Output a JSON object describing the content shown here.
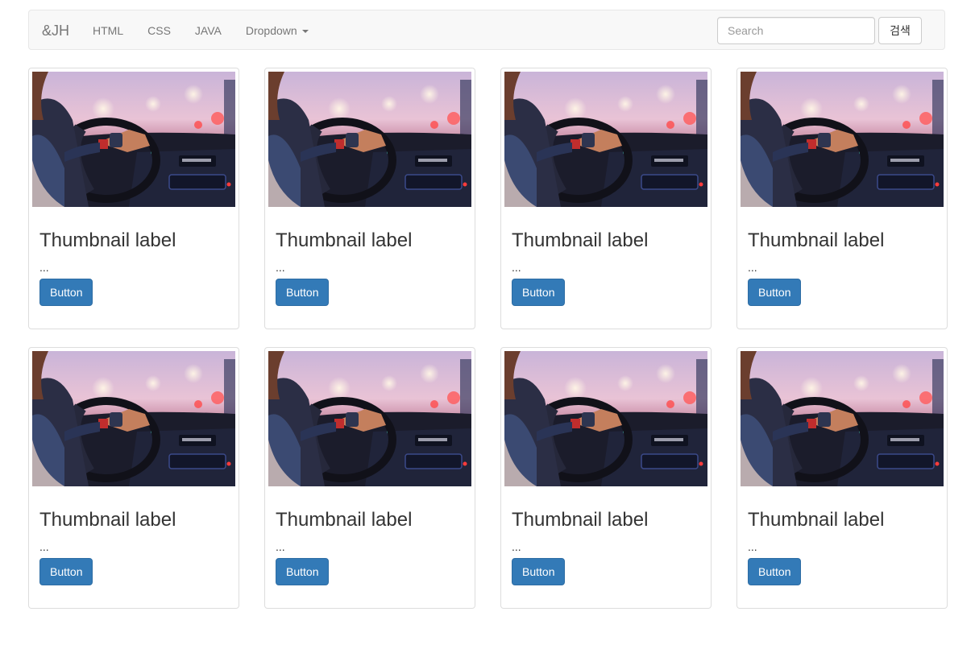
{
  "navbar": {
    "brand": "&JH",
    "items": [
      {
        "label": "HTML"
      },
      {
        "label": "CSS"
      },
      {
        "label": "JAVA"
      },
      {
        "label": "Dropdown"
      }
    ],
    "search_placeholder": "Search",
    "search_button": "검색"
  },
  "cards": [
    {
      "title": "Thumbnail label",
      "text": "...",
      "button": "Button"
    },
    {
      "title": "Thumbnail label",
      "text": "...",
      "button": "Button"
    },
    {
      "title": "Thumbnail label",
      "text": "...",
      "button": "Button"
    },
    {
      "title": "Thumbnail label",
      "text": "...",
      "button": "Button"
    },
    {
      "title": "Thumbnail label",
      "text": "...",
      "button": "Button"
    },
    {
      "title": "Thumbnail label",
      "text": "...",
      "button": "Button"
    },
    {
      "title": "Thumbnail label",
      "text": "...",
      "button": "Button"
    },
    {
      "title": "Thumbnail label",
      "text": "...",
      "button": "Button"
    }
  ],
  "colors": {
    "primary": "#337ab7",
    "navbar_bg": "#f8f8f8",
    "nav_text": "#777777"
  }
}
